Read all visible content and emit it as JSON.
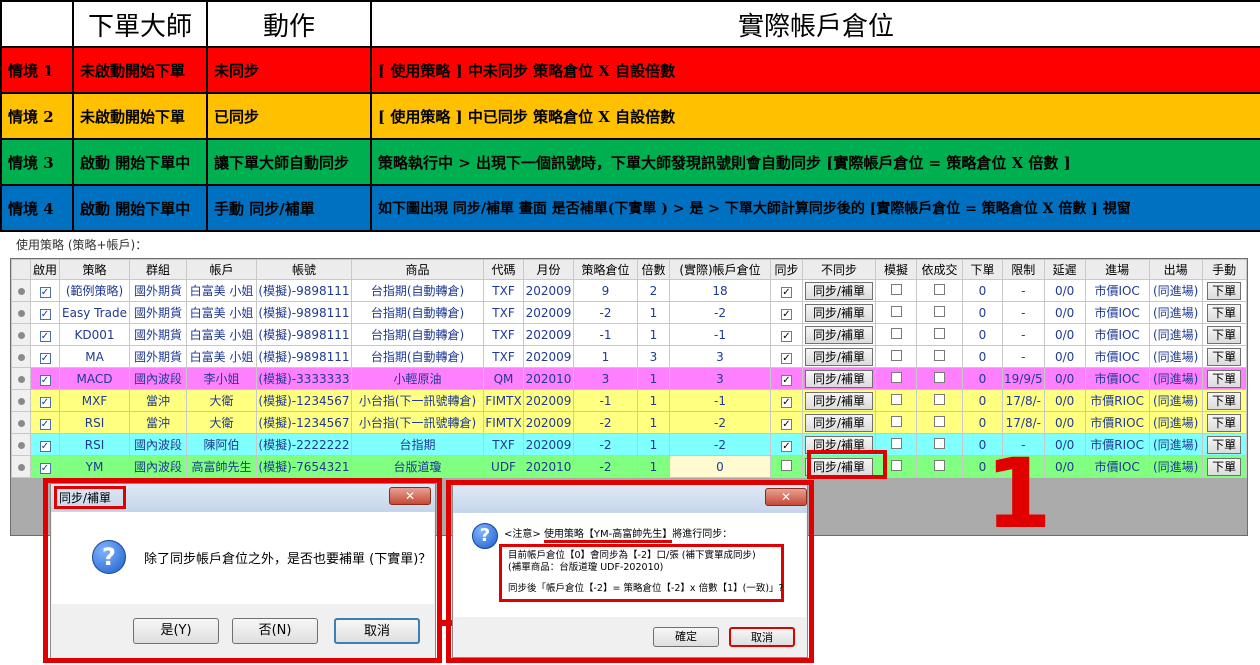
{
  "scenario_table": {
    "headers": [
      "",
      "下單大師",
      "動作",
      "實際帳戶倉位"
    ],
    "rows": [
      {
        "label": "情境 1",
        "master": "未啟動開始下單",
        "action": "未同步",
        "position": "[ 使用策略 ] 中未同步 策略倉位 X 自設倍數"
      },
      {
        "label": "情境 2",
        "master": "未啟動開始下單",
        "action": "已同步",
        "position": "[ 使用策略 ] 中已同步 策略倉位 X 自設倍數"
      },
      {
        "label": "情境 3",
        "master": "啟動 開始下單中",
        "action": "讓下單大師自動同步",
        "position": "策略執行中 > 出現下一個訊號時，下單大師發現訊號則會自動同步 [實際帳戶倉位 = 策略倉位 X 倍數 ]"
      },
      {
        "label": "情境 4",
        "master": "啟動 開始下單中",
        "action": "手動 同步/補單",
        "position": "如下圖出現 同步/補單 畫面 是否補單(下實單 ) > 是 > 下單大師計算同步後的 [實際帳戶倉位 = 策略倉位 X 倍數 ] 視窗"
      }
    ]
  },
  "strategy_caption": "使用策略 (策略+帳戶)：",
  "grid": {
    "headers": [
      "",
      "啟用",
      "策略",
      "群組",
      "帳戶",
      "帳號",
      "商品",
      "代碼",
      "月份",
      "策略倉位",
      "倍數",
      "(實際)帳戶倉位",
      "同步",
      "不同步",
      "模擬",
      "依成交",
      "下單",
      "限制",
      "延遲",
      "進場",
      "出場",
      "手動"
    ],
    "rows": [
      {
        "strategy": "(範例策略)",
        "group": "國外期貨",
        "account": "白富美 小姐",
        "account_no": "(模擬)-9898111",
        "product": "台指期(自動轉倉)",
        "code": "TXF",
        "month": "202009",
        "strategy_pos": "9",
        "multiplier": "2",
        "actual_pos": "18",
        "not_sync_btn": "同步/補單",
        "order_count": "0",
        "limit": "-",
        "delay": "0/0",
        "entry": "市價IOC",
        "exit": "(同進場)",
        "manual_btn": "下單"
      },
      {
        "strategy": "Easy Trade",
        "group": "國外期貨",
        "account": "白富美 小姐",
        "account_no": "(模擬)-9898111",
        "product": "台指期(自動轉倉)",
        "code": "TXF",
        "month": "202009",
        "strategy_pos": "-2",
        "multiplier": "1",
        "actual_pos": "-2",
        "not_sync_btn": "同步/補單",
        "order_count": "0",
        "limit": "-",
        "delay": "0/0",
        "entry": "市價IOC",
        "exit": "(同進場)",
        "manual_btn": "下單"
      },
      {
        "strategy": "KD001",
        "group": "國外期貨",
        "account": "白富美 小姐",
        "account_no": "(模擬)-9898111",
        "product": "台指期(自動轉倉)",
        "code": "TXF",
        "month": "202009",
        "strategy_pos": "-1",
        "multiplier": "1",
        "actual_pos": "-1",
        "not_sync_btn": "同步/補單",
        "order_count": "0",
        "limit": "-",
        "delay": "0/0",
        "entry": "市價IOC",
        "exit": "(同進場)",
        "manual_btn": "下單"
      },
      {
        "strategy": "MA",
        "group": "國外期貨",
        "account": "白富美 小姐",
        "account_no": "(模擬)-9898111",
        "product": "台指期(自動轉倉)",
        "code": "TXF",
        "month": "202009",
        "strategy_pos": "1",
        "multiplier": "3",
        "actual_pos": "3",
        "not_sync_btn": "同步/補單",
        "order_count": "0",
        "limit": "-",
        "delay": "0/0",
        "entry": "市價IOC",
        "exit": "(同進場)",
        "manual_btn": "下單"
      },
      {
        "strategy": "MACD",
        "group": "國內波段",
        "account": "李小姐",
        "account_no": "(模擬)-3333333",
        "product": "小輕原油",
        "code": "QM",
        "month": "202010",
        "strategy_pos": "3",
        "multiplier": "1",
        "actual_pos": "3",
        "not_sync_btn": "同步/補單",
        "order_count": "0",
        "limit": "19/9/5",
        "delay": "0/0",
        "entry": "市價IOC",
        "exit": "(同進場)",
        "manual_btn": "下單"
      },
      {
        "strategy": "MXF",
        "group": "當沖",
        "account": "大衛",
        "account_no": "(模擬)-1234567",
        "product": "小台指(下一訊號轉倉)",
        "code": "FIMTX",
        "month": "202009",
        "strategy_pos": "-1",
        "multiplier": "1",
        "actual_pos": "-1",
        "not_sync_btn": "同步/補單",
        "order_count": "0",
        "limit": "17/8/-",
        "delay": "0/0",
        "entry": "市價RIOC",
        "exit": "(同進場)",
        "manual_btn": "下單"
      },
      {
        "strategy": "RSI",
        "group": "當沖",
        "account": "大衛",
        "account_no": "(模擬)-1234567",
        "product": "小台指(下一訊號轉倉)",
        "code": "FIMTX",
        "month": "202009",
        "strategy_pos": "-2",
        "multiplier": "1",
        "actual_pos": "-2",
        "not_sync_btn": "同步/補單",
        "order_count": "0",
        "limit": "17/8/-",
        "delay": "0/0",
        "entry": "市價RIOC",
        "exit": "(同進場)",
        "manual_btn": "下單"
      },
      {
        "strategy": "RSI",
        "group": "國內波段",
        "account": "陳阿伯",
        "account_no": "(模擬)-2222222",
        "product": "台指期",
        "code": "TXF",
        "month": "202009",
        "strategy_pos": "-2",
        "multiplier": "1",
        "actual_pos": "-2",
        "not_sync_btn": "同步/補單",
        "order_count": "0",
        "limit": "-",
        "delay": "0/0",
        "entry": "市價RIOC",
        "exit": "(同進場)",
        "manual_btn": "下單"
      },
      {
        "strategy": "YM",
        "group": "國內波段",
        "account": "高富帥先生",
        "account_no": "(模擬)-7654321",
        "product": "台版道瓊",
        "code": "UDF",
        "month": "202010",
        "strategy_pos": "-2",
        "multiplier": "1",
        "actual_pos": "0",
        "not_sync_btn": "同步/補單",
        "order_count": "0",
        "limit": "-",
        "delay": "0/0",
        "entry": "市價IOC",
        "exit": "(同進場)",
        "manual_btn": "下單"
      }
    ]
  },
  "callout_number": "1",
  "dialog1": {
    "title": "同步/補單",
    "message": "除了同步帳戶倉位之外，是否也要補單 (下實單)？",
    "yes_button": "是(Y)",
    "no_button": "否(N)",
    "cancel_button": "取消"
  },
  "dialog2": {
    "notice_prefix": "<注意> ",
    "notice_strategy": "使用策略【YM-高富帥先生】",
    "notice_suffix": "將進行同步：",
    "line1": "目前帳戶倉位【0】會同步為【-2】口/張 (補下實單成同步)",
    "line2": "(補單商品：台版道瓊 UDF-202010)",
    "line3": "同步後「帳戶倉位【-2】= 策略倉位【-2】x 倍數【1】(一致)」?",
    "ok_button": "確定",
    "cancel_button": "取消"
  },
  "colors": {
    "accent_red": "#e00000",
    "row_red": "#ff0000",
    "row_yellow": "#ffc000",
    "row_green": "#00b050",
    "row_blue": "#0070c0"
  }
}
